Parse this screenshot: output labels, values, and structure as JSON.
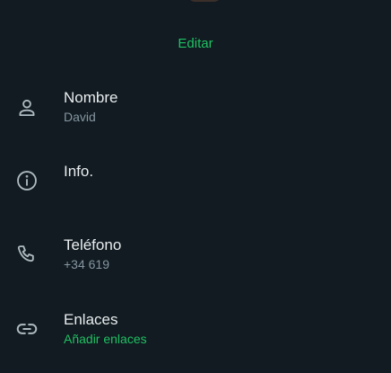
{
  "profile": {
    "edit_label": "Editar",
    "accent_color": "#21c063",
    "background_color": "#111b21"
  },
  "fields": {
    "name": {
      "icon": "person-icon",
      "label": "Nombre",
      "value": "David"
    },
    "info": {
      "icon": "info-icon",
      "label": "Info."
    },
    "phone": {
      "icon": "phone-icon",
      "label": "Teléfono",
      "value": "+34 619"
    },
    "links": {
      "icon": "link-icon",
      "label": "Enlaces",
      "value": "Añadir enlaces"
    }
  }
}
